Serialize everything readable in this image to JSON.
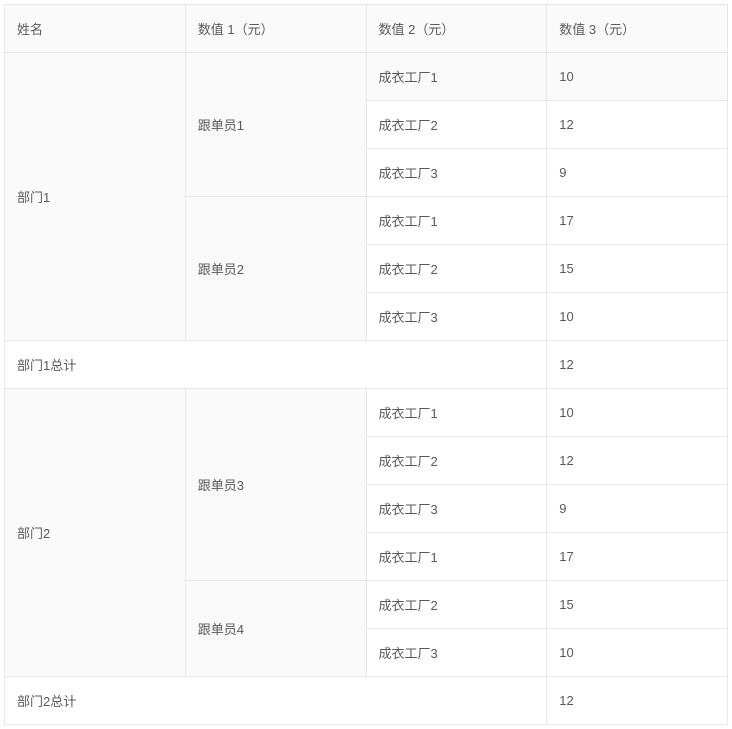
{
  "headers": {
    "name": "姓名",
    "v1": "数值 1（元）",
    "v2": "数值 2（元）",
    "v3": "数值 3（元）"
  },
  "rows": [
    {
      "group1": "部门1",
      "group1_rowspan": 6,
      "group2": "跟单员1",
      "group2_rowspan": 3,
      "v2": "成衣工厂1",
      "v3": "10",
      "hover": true
    },
    {
      "v2": "成衣工厂2",
      "v3": "12"
    },
    {
      "v2": "成衣工厂3",
      "v3": "9"
    },
    {
      "group2": "跟单员2",
      "group2_rowspan": 3,
      "v2": "成衣工厂1",
      "v3": "17"
    },
    {
      "v2": "成衣工厂2",
      "v3": "15"
    },
    {
      "v2": "成衣工厂3",
      "v3": "10"
    },
    {
      "total_label": "部门1总计",
      "total_colspan": 3,
      "v3": "12"
    },
    {
      "group1": "部门2",
      "group1_rowspan": 6,
      "group2": "跟单员3",
      "group2_rowspan": 4,
      "v2": "成衣工厂1",
      "v3": "10"
    },
    {
      "v2": "成衣工厂2",
      "v3": "12"
    },
    {
      "v2": "成衣工厂3",
      "v3": "9"
    },
    {
      "v2": "成衣工厂1",
      "v3": "17"
    },
    {
      "group2": "跟单员4",
      "group2_rowspan": 2,
      "v2": "成衣工厂2",
      "v3": "15"
    },
    {
      "v2": "成衣工厂3",
      "v3": "10"
    },
    {
      "total_label": "部门2总计",
      "total_colspan": 3,
      "v3": "12"
    }
  ]
}
